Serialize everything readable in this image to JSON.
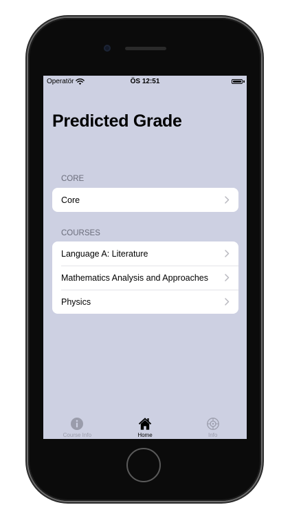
{
  "status_bar": {
    "carrier": "Operatör",
    "time": "ÖS 12:51"
  },
  "page": {
    "title": "Predicted Grade"
  },
  "sections": {
    "core": {
      "header": "CORE",
      "items": [
        {
          "label": "Core"
        }
      ]
    },
    "courses": {
      "header": "COURSES",
      "items": [
        {
          "label": "Language A: Literature"
        },
        {
          "label": "Mathematics Analysis and Approaches"
        },
        {
          "label": "Physics"
        }
      ]
    }
  },
  "tab_bar": {
    "tabs": [
      {
        "label": "Course Info",
        "icon": "info-icon",
        "selected": false
      },
      {
        "label": "Home",
        "icon": "house-icon",
        "selected": true
      },
      {
        "label": "Info",
        "icon": "gear-icon",
        "selected": false
      }
    ]
  },
  "colors": {
    "background": "#cdd0e2",
    "card": "#ffffff",
    "section_header": "#6a6c7a",
    "tab_inactive": "#9a9cab",
    "tab_active": "#000000"
  }
}
